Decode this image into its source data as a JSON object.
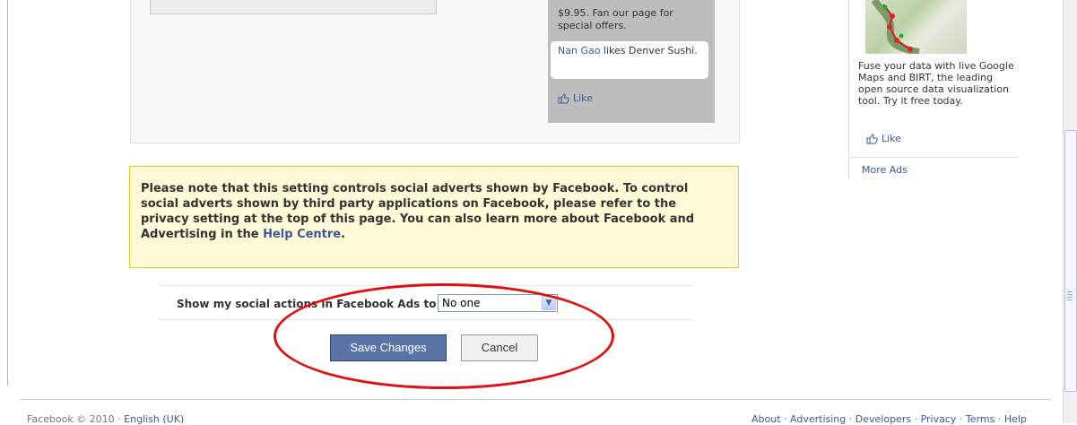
{
  "ad_preview": {
    "ad_text": "$9.95. Fan our page for special offers.",
    "social_name": "Nan Gao",
    "social_text": " likes Denver Sushi.",
    "like_label": "Like"
  },
  "right_ad": {
    "text": "Fuse your data with live Google Maps and BIRT, the leading open source data visualization tool. Try it free today.",
    "like_label": "Like",
    "more_ads": "More Ads"
  },
  "notice": {
    "text": "Please note that this setting controls social adverts shown by Facebook. To control social adverts shown by third party applications on Facebook, please refer to the privacy setting at the top of this page. You can also learn more about Facebook and Advertising in the ",
    "link": "Help Centre",
    "end": "."
  },
  "setting": {
    "label": "Show my social actions in Facebook Ads to",
    "selected": "No one"
  },
  "buttons": {
    "save": "Save Changes",
    "cancel": "Cancel"
  },
  "footer": {
    "copyright": "Facebook © 2010 · ",
    "language": "English (UK)",
    "links": [
      "About",
      "Advertising",
      "Developers",
      "Privacy",
      "Terms",
      "Help"
    ]
  },
  "colors": {
    "link": "#3b5998",
    "annotation": "#e01010",
    "notice_bg": "#fff9d7"
  }
}
